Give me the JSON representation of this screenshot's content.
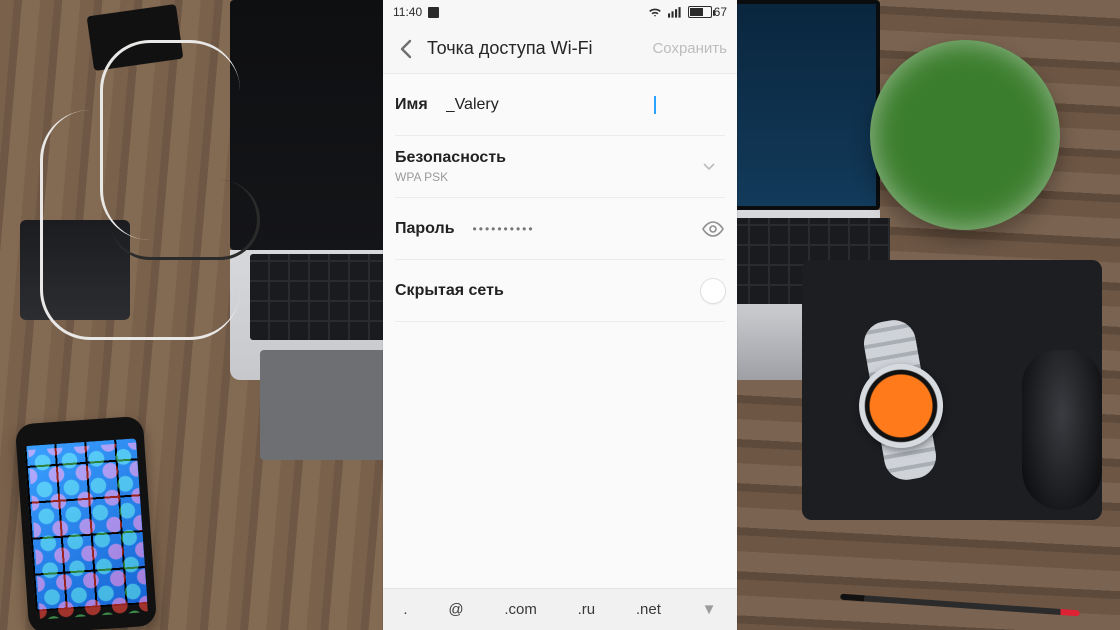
{
  "statusbar": {
    "time": "11:40",
    "battery": "67"
  },
  "navbar": {
    "title": "Точка доступа Wi-Fi",
    "save": "Сохранить"
  },
  "form": {
    "name": {
      "label": "Имя",
      "value": "_Valery"
    },
    "security": {
      "label": "Безопасность",
      "value": "WPA PSK"
    },
    "password": {
      "label": "Пароль",
      "mask": "••••••••••"
    },
    "hidden": {
      "label": "Скрытая сеть"
    }
  },
  "keyboard": {
    "k1": ".",
    "k2": "@",
    "k3": ".com",
    "k4": ".ru",
    "k5": ".net"
  }
}
